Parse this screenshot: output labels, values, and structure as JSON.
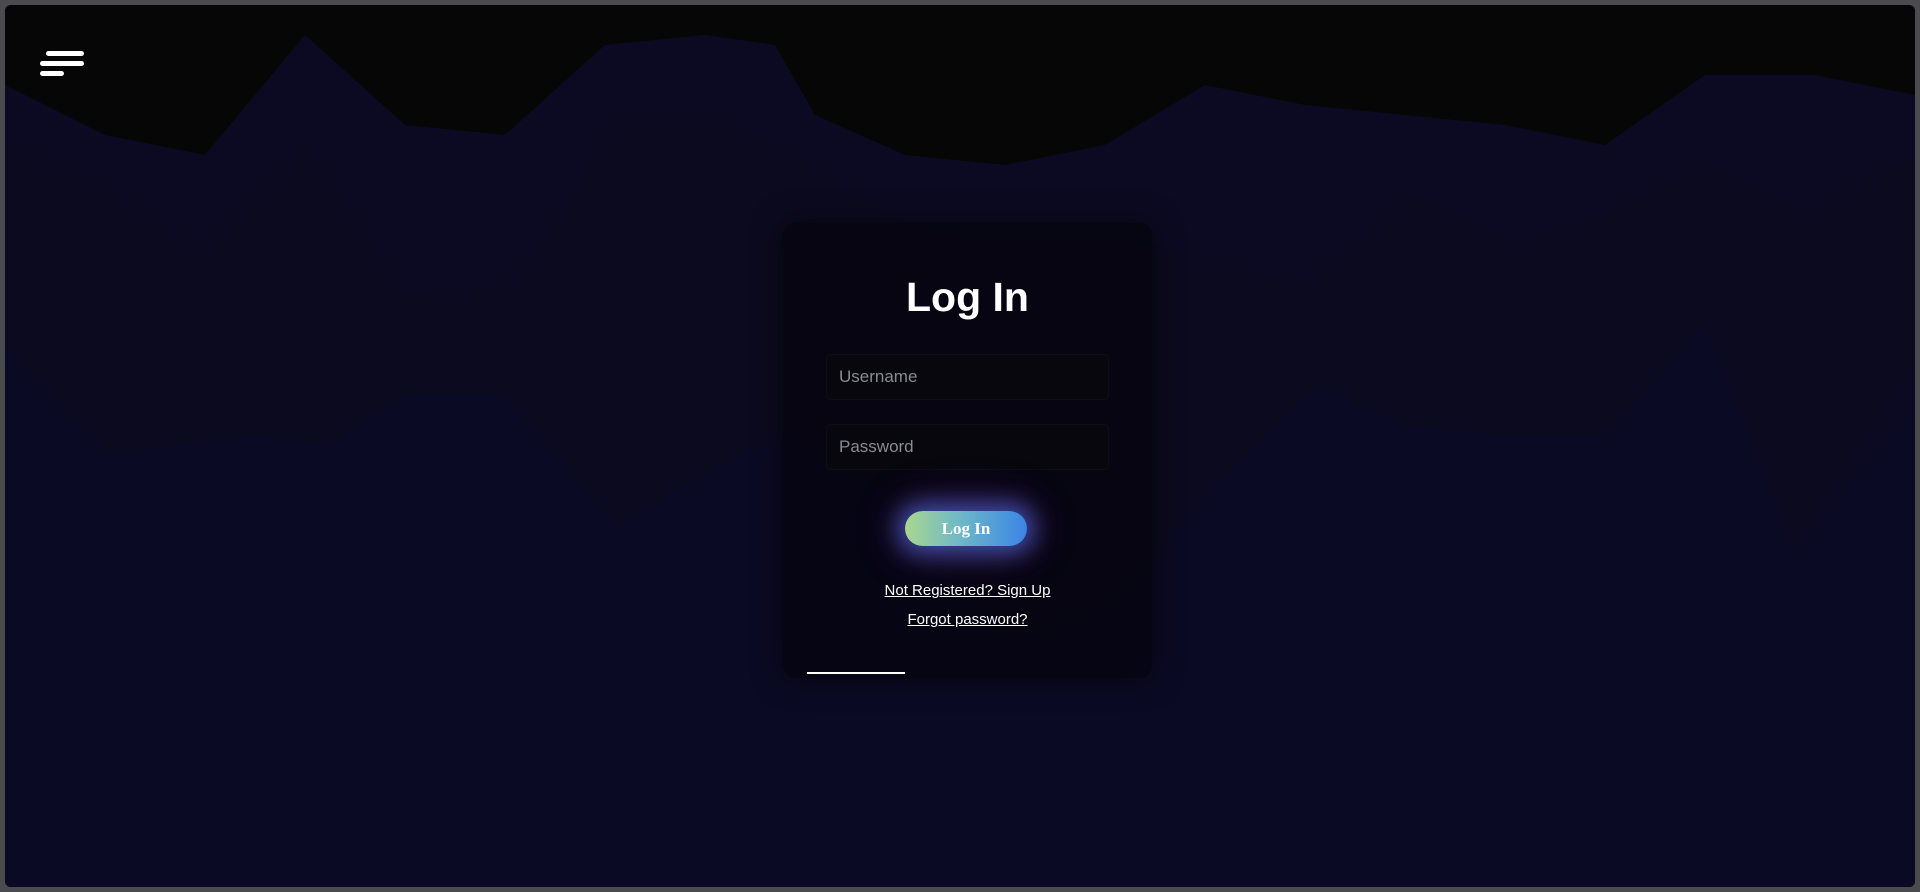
{
  "page": {
    "title": "Log In"
  },
  "form": {
    "username_placeholder": "Username",
    "password_placeholder": "Password",
    "submit_label": "Log In",
    "signup_link": "Not Registered? Sign Up",
    "forgot_link": "Forgot password?"
  },
  "nav": {
    "menu_icon": "hamburger-menu-icon"
  },
  "colors": {
    "background": "#0c0a20",
    "top_dark": "#060606",
    "button_gradient_start": "#a9d690",
    "button_gradient_end": "#3b84e6",
    "text": "#ffffff"
  }
}
